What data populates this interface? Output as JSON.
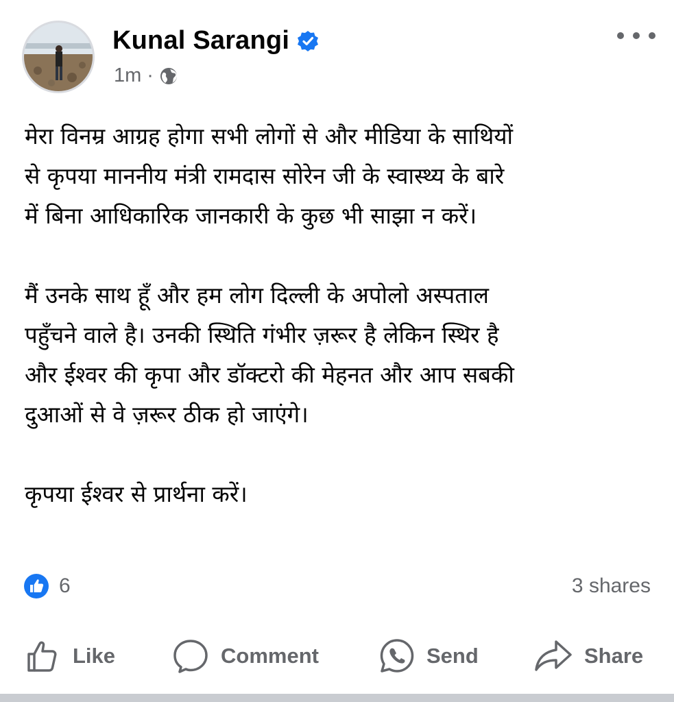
{
  "post": {
    "author": "Kunal Sarangi",
    "timestamp": "1m",
    "separator": "·",
    "privacy_icon": "globe-icon",
    "verified_icon": "verified-badge-icon",
    "more_icon": "more-options-icon",
    "paragraphs": [
      "मेरा विनम्र आग्रह होगा सभी लोगों से और मीडिया के साथियों\nसे कृपया माननीय मंत्री रामदास सोरेन जी के स्वास्थ्य के बारे\nमें बिना आधिकारिक जानकारी के कुछ भी साझा न करें।",
      "मैं उनके साथ हूँ और हम लोग दिल्ली के अपोलो अस्पताल\nपहुँचने वाले है। उनकी स्थिति गंभीर ज़रूर है लेकिन स्थिर है\nऔर ईश्वर की कृपा और डॉक्टरो की मेहनत और आप सबकी\nदुआओं से वे ज़रूर ठीक हो जाएंगे।",
      "कृपया ईश्वर से प्रार्थना करें।"
    ]
  },
  "stats": {
    "reaction_count": "6",
    "shares": "3 shares"
  },
  "actions": {
    "like": "Like",
    "comment": "Comment",
    "send": "Send",
    "share": "Share"
  },
  "colors": {
    "brand_blue": "#1877f2",
    "secondary_text": "#65676b",
    "primary_text": "#050505"
  }
}
